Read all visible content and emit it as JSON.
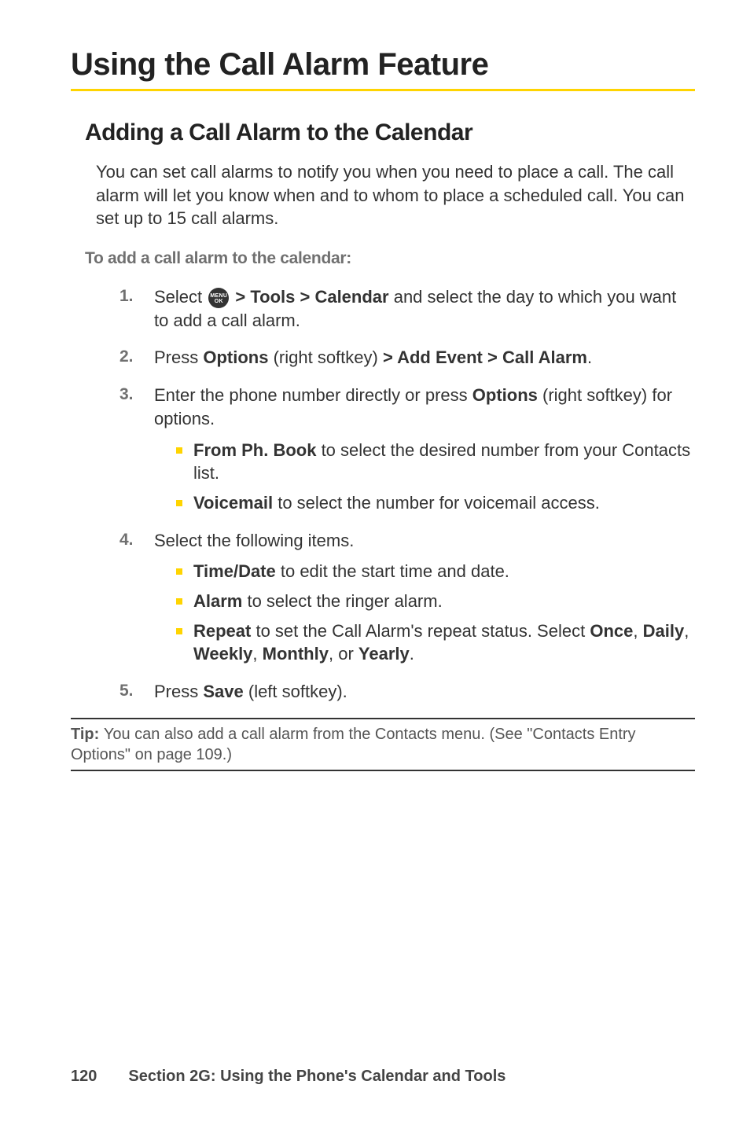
{
  "title": "Using the Call Alarm Feature",
  "subtitle": "Adding a Call Alarm to the Calendar",
  "intro": "You can set call alarms to notify you when you need to place a call. The call alarm will let you know when and to whom to place a scheduled call. You can set up to 15 call alarms.",
  "procedure_title": "To add a call alarm to the calendar:",
  "menu_icon": {
    "line1": "MENU",
    "line2": "OK"
  },
  "steps": {
    "s1": {
      "num": "1.",
      "pre": "Select ",
      "path": " > Tools > Calendar",
      "post": " and select the day to which you want to add a call alarm."
    },
    "s2": {
      "num": "2.",
      "a": "Press ",
      "b": "Options",
      "c": " (right softkey) ",
      "d": "> Add Event > Call Alarm",
      "e": "."
    },
    "s3": {
      "num": "3.",
      "a": "Enter the phone number directly or press ",
      "b": "Options",
      "c": " (right softkey) for options.",
      "sub1": {
        "b": "From Ph. Book",
        "t": " to select the desired number from your Contacts list."
      },
      "sub2": {
        "b": "Voicemail",
        "t": " to select the number for voicemail access."
      }
    },
    "s4": {
      "num": "4.",
      "a": "Select the following items.",
      "sub1": {
        "b": "Time/Date",
        "t": " to edit the start time and date."
      },
      "sub2": {
        "b": "Alarm",
        "t": " to select the ringer alarm."
      },
      "sub3": {
        "b": "Repeat",
        "t1": " to set the Call Alarm's repeat status. Select ",
        "o1": "Once",
        "c1": ", ",
        "o2": "Daily",
        "c2": ", ",
        "o3": "Weekly",
        "c3": ", ",
        "o4": "Monthly",
        "c4": ", or ",
        "o5": "Yearly",
        "c5": "."
      }
    },
    "s5": {
      "num": "5.",
      "a": "Press ",
      "b": "Save",
      "c": " (left softkey)."
    }
  },
  "tip": {
    "label": "Tip: ",
    "text": "You can also add a call alarm from the Contacts menu. (See \"Contacts Entry Options\" on page 109.)"
  },
  "footer": {
    "page": "120",
    "section": "Section 2G: Using the Phone's Calendar and Tools"
  }
}
